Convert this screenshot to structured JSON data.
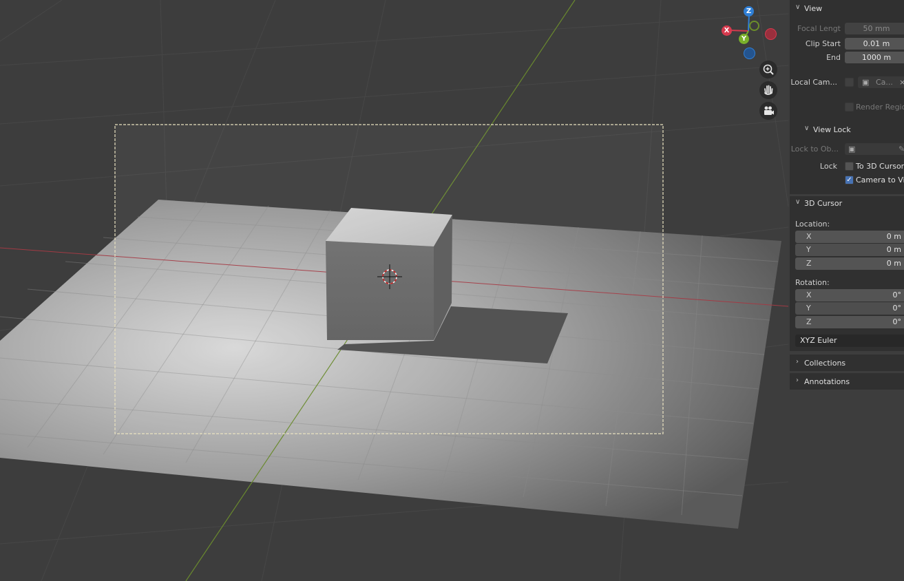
{
  "gizmo": {
    "z_label": "Z",
    "x_label": "X",
    "y_label": "Y",
    "colors": {
      "x": "#d63a4e",
      "y": "#7ab02a",
      "z": "#2f7fd6"
    }
  },
  "nav": {
    "zoom_icon": "zoom-in-icon",
    "pan_icon": "hand-icon",
    "camera_icon": "camera-icon"
  },
  "panel": {
    "view": {
      "title": "View",
      "focal_length_label": "Focal Lengt",
      "focal_length_value": "50 mm",
      "clip_start_label": "Clip Start",
      "clip_start_value": "0.01 m",
      "end_label": "End",
      "end_value": "1000 m",
      "local_camera_label": "Local Cam...",
      "local_camera_value": "Ca...",
      "render_region_label": "Render Region"
    },
    "view_lock": {
      "title": "View Lock",
      "lock_to_object_label": "Lock to Ob...",
      "lock_label": "Lock",
      "to_3d_cursor_label": "To 3D Cursor",
      "camera_to_view_label": "Camera to Vi..."
    },
    "cursor": {
      "title": "3D Cursor",
      "location_label": "Location:",
      "location": [
        {
          "axis": "X",
          "value": "0 m"
        },
        {
          "axis": "Y",
          "value": "0 m"
        },
        {
          "axis": "Z",
          "value": "0 m"
        }
      ],
      "rotation_label": "Rotation:",
      "rotation": [
        {
          "axis": "X",
          "value": "0°"
        },
        {
          "axis": "Y",
          "value": "0°"
        },
        {
          "axis": "Z",
          "value": "0°"
        }
      ],
      "rotation_mode": "XYZ Euler"
    },
    "collections": {
      "title": "Collections"
    },
    "annotations": {
      "title": "Annotations"
    }
  }
}
